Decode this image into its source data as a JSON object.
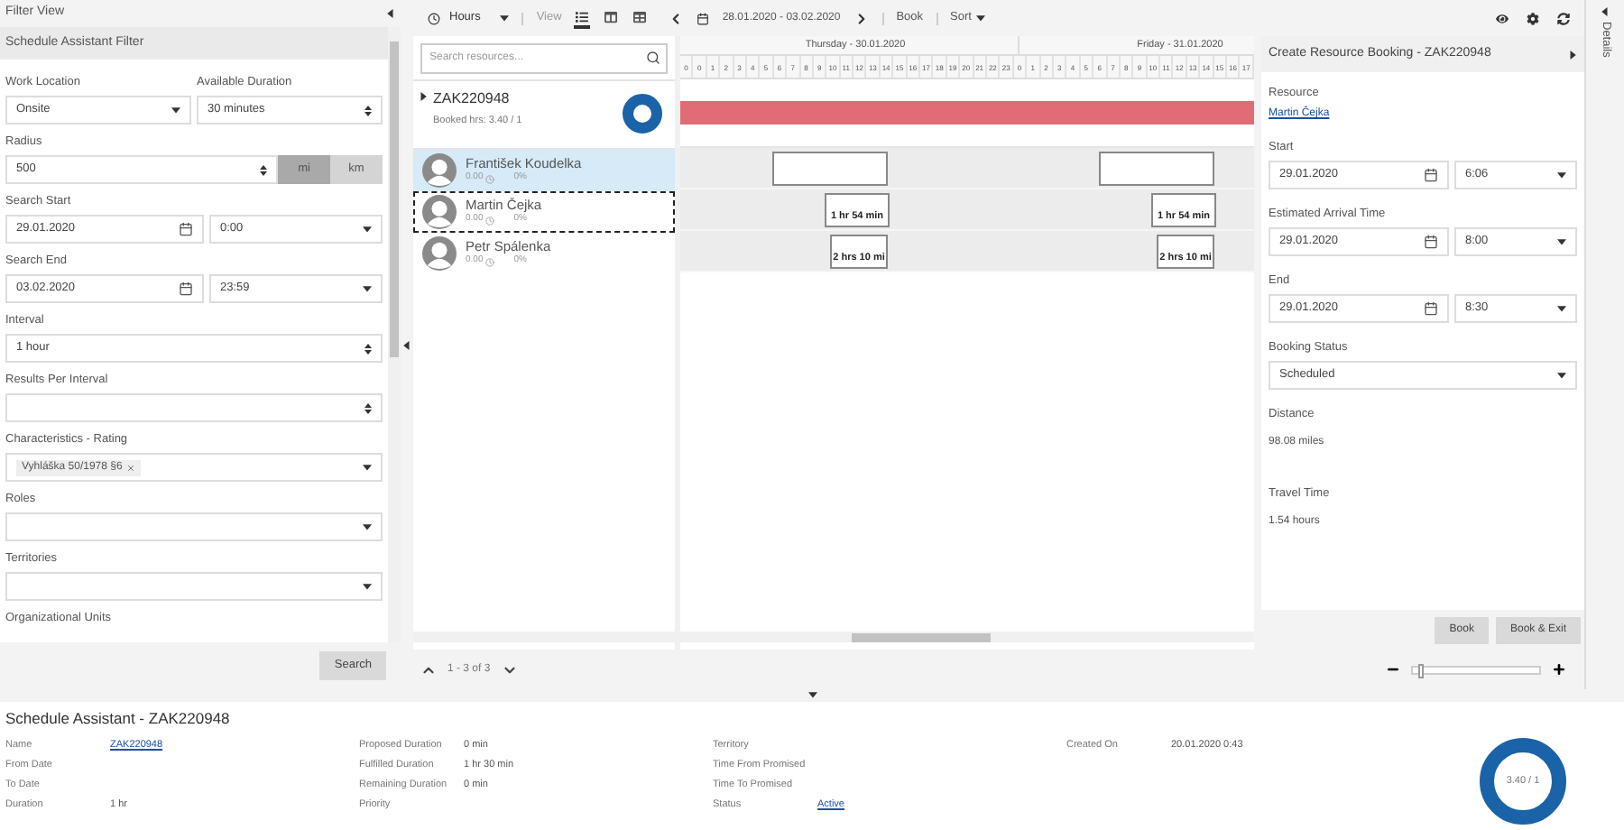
{
  "filter_panel": {
    "title": "Filter View",
    "subtitle": "Schedule Assistant Filter",
    "rows": [
      {
        "fields": [
          {
            "label": "Work Location",
            "kind": "select",
            "value": "Onsite"
          },
          {
            "label": "Available Duration",
            "kind": "spinner",
            "value": "30 minutes"
          }
        ]
      },
      {
        "fields": [
          {
            "label": "Radius",
            "kind": "unit",
            "value": "500",
            "units": [
              {
                "label": "mi",
                "selected": true
              },
              {
                "label": "km",
                "selected": false
              }
            ]
          }
        ]
      },
      {
        "fields": [
          {
            "label": "Search Start",
            "kind": "datetime",
            "date": "29.01.2020",
            "time": "0:00"
          }
        ]
      },
      {
        "fields": [
          {
            "label": "Search End",
            "kind": "datetime",
            "date": "03.02.2020",
            "time": "23:59"
          }
        ]
      },
      {
        "fields": [
          {
            "label": "Interval",
            "kind": "spinner",
            "value": "1 hour"
          }
        ]
      },
      {
        "fields": [
          {
            "label": "Results Per Interval",
            "kind": "spinner"
          }
        ]
      },
      {
        "fields": [
          {
            "label": "Characteristics - Rating",
            "kind": "tags",
            "tags": [
              "Vyhláška 50/1978 §6"
            ]
          }
        ]
      },
      {
        "fields": [
          {
            "label": "Roles",
            "kind": "select"
          }
        ]
      },
      {
        "fields": [
          {
            "label": "Territories",
            "kind": "select"
          }
        ]
      },
      {
        "fields": [
          {
            "label": "Organizational Units",
            "kind": "label"
          }
        ]
      }
    ],
    "search_button": "Search"
  },
  "toolbar": {
    "scale": "Hours",
    "view_label": "View",
    "views": [
      {
        "kind": "list",
        "selected": true
      },
      {
        "kind": "columns",
        "selected": false
      },
      {
        "kind": "table",
        "selected": false
      }
    ],
    "date_range": "28.01.2020 - 03.02.2020",
    "book": "Book",
    "sort": "Sort"
  },
  "resources": {
    "search_placeholder": "Search resources...",
    "requirement": {
      "name": "ZAK220948",
      "booked": "Booked hrs: 3.40 / 1"
    },
    "items": [
      {
        "name": "František Koudelka",
        "hours": "0.00",
        "percent": "0%",
        "selected": true,
        "focused": false,
        "bookings": [
          {
            "kind": "outline"
          },
          {
            "kind": "outline"
          }
        ]
      },
      {
        "name": "Martin Čejka",
        "hours": "0.00",
        "percent": "0%",
        "selected": false,
        "focused": true,
        "bookings": [
          {
            "kind": "travel",
            "label": "1 hr 54 min"
          },
          {
            "kind": "travel",
            "label": "1 hr 54 min"
          }
        ]
      },
      {
        "name": "Petr Spálenka",
        "hours": "0.00",
        "percent": "0%",
        "selected": false,
        "focused": false,
        "bookings": [
          {
            "kind": "travel",
            "label": "2 hrs 10 mi"
          },
          {
            "kind": "travel",
            "label": "2 hrs 10 mi"
          }
        ]
      }
    ],
    "pagination": "1 - 3 of 3"
  },
  "timeline": {
    "days": [
      "Thursday - 30.01.2020",
      "Friday - 31.01.2020"
    ],
    "hours": [
      "0",
      "0",
      "1",
      "2",
      "3",
      "4",
      "5",
      "6",
      "7",
      "8",
      "9",
      "10",
      "11",
      "12",
      "13",
      "14",
      "15",
      "16",
      "17",
      "18",
      "19",
      "20",
      "21",
      "22",
      "23",
      "0",
      "1",
      "2",
      "3",
      "4",
      "5",
      "6",
      "7",
      "8",
      "9",
      "10",
      "11",
      "12",
      "13",
      "14",
      "15",
      "16",
      "17"
    ]
  },
  "zoom": {
    "level": 0.04
  },
  "booking_panel": {
    "title": "Create Resource Booking - ZAK220948",
    "fields": [
      {
        "label": "Resource",
        "kind": "link",
        "value": "Martin Čejka"
      },
      {
        "label": "Start",
        "kind": "datetime",
        "date": "29.01.2020",
        "time": "6:06"
      },
      {
        "label": "Estimated Arrival Time",
        "kind": "datetime",
        "date": "29.01.2020",
        "time": "8:00"
      },
      {
        "label": "End",
        "kind": "datetime",
        "date": "29.01.2020",
        "time": "8:30"
      },
      {
        "label": "Booking Status",
        "kind": "select",
        "value": "Scheduled"
      },
      {
        "label": "Distance",
        "kind": "text",
        "value": "98.08 miles"
      },
      {
        "label": "Travel Time",
        "kind": "text",
        "value": "1.54 hours"
      }
    ],
    "buttons": [
      "Book",
      "Book & Exit"
    ]
  },
  "details_tab": "Details",
  "summary": {
    "title": "Schedule Assistant - ZAK220948",
    "columns": [
      [
        {
          "label": "Name",
          "value": "ZAK220948",
          "kind": "link"
        },
        {
          "label": "From Date"
        },
        {
          "label": "To Date"
        },
        {
          "label": "Duration",
          "value": "1 hr",
          "kind": "text"
        }
      ],
      [
        {
          "label": "Proposed Duration",
          "value": "0 min",
          "kind": "text"
        },
        {
          "label": "Fulfilled Duration",
          "value": "1 hr 30 min",
          "kind": "text"
        },
        {
          "label": "Remaining Duration",
          "value": "0 min",
          "kind": "text"
        },
        {
          "label": "Priority"
        }
      ],
      [
        {
          "label": "Territory"
        },
        {
          "label": "Time From Promised"
        },
        {
          "label": "Time To Promised"
        },
        {
          "label": "Status",
          "value": "Active",
          "kind": "link"
        }
      ],
      [
        {
          "label": "Created On",
          "value": "20.01.2020 0:43",
          "kind": "text"
        }
      ]
    ],
    "donut_label": "3.40 / 1"
  }
}
